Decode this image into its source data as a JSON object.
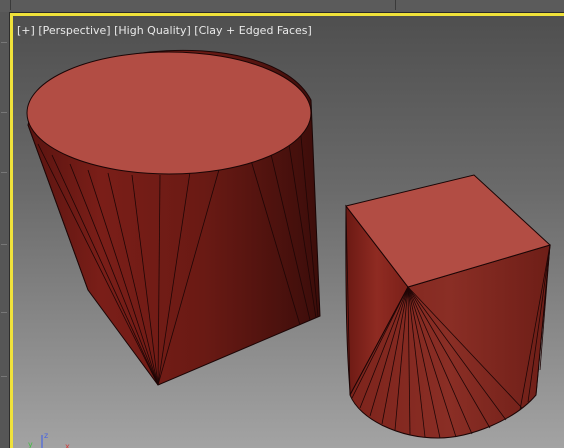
{
  "viewport": {
    "label_parts": [
      "[+]",
      "[Perspective]",
      "[High Quality]",
      "[Clay + Edged Faces]"
    ],
    "border_color": "#f0e23a"
  },
  "scene": {
    "objects": [
      {
        "name": "cylinder",
        "color": "#a9433b"
      },
      {
        "name": "box-cylinder",
        "color": "#a9433b"
      }
    ]
  },
  "axis_gizmo": {
    "labels": [
      "z",
      "y",
      "x"
    ],
    "colors": {
      "x": "#d23a3a",
      "y": "#3fbf3f",
      "z": "#4a66e0"
    }
  }
}
